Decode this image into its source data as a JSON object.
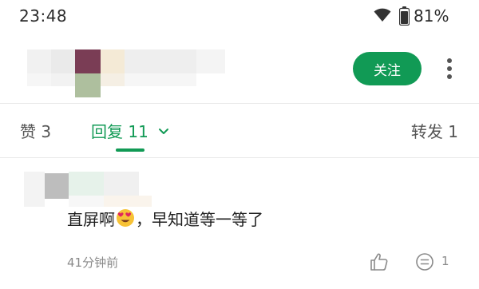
{
  "status_bar": {
    "time": "23:48",
    "battery": "81%"
  },
  "header": {
    "follow_label": "关注"
  },
  "tabs": {
    "likes": "赞 3",
    "replies": "回复 11",
    "reposts": "转发 1"
  },
  "comment": {
    "text_before_emoji": "直屏啊",
    "emoji": "heart-eyes-emoji",
    "text_after_emoji": "，早知道等一等了",
    "time": "41分钟前",
    "reply_count": "1"
  },
  "colors": {
    "accent": "#119a55"
  }
}
